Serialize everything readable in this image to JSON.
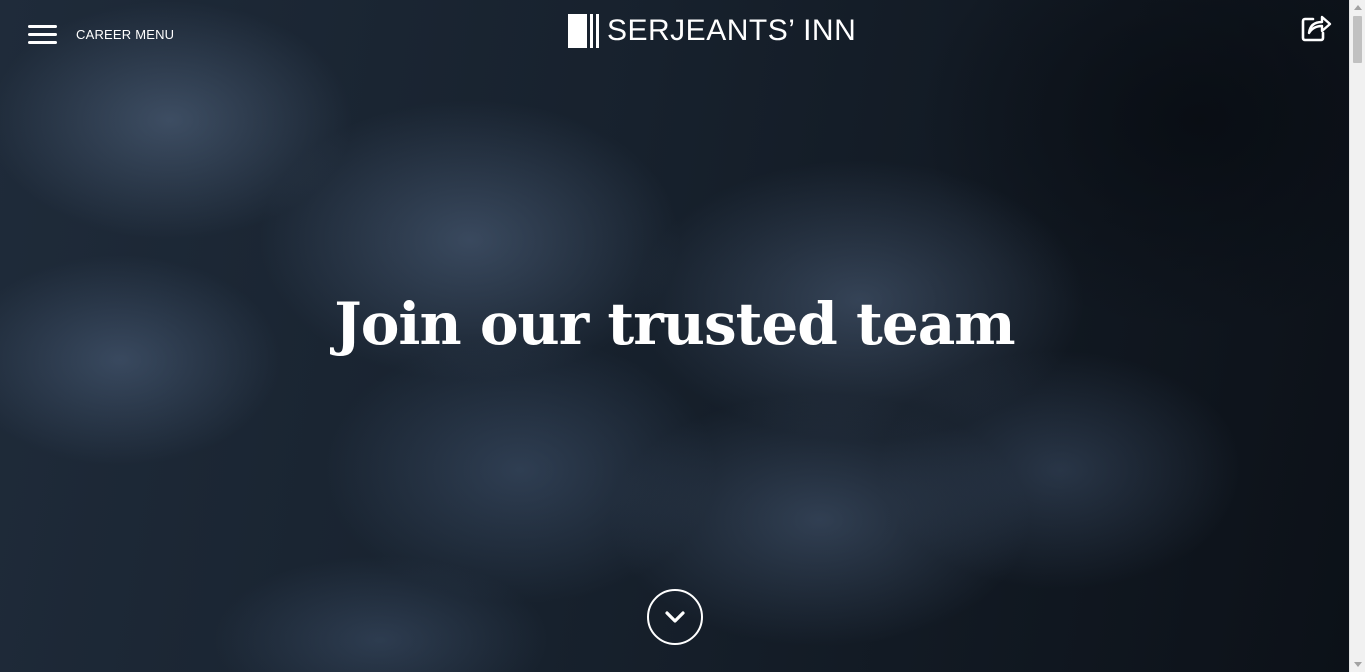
{
  "header": {
    "menu_label": "CAREER MENU",
    "logo_text": "SERJEANTS’ INN"
  },
  "icons": {
    "menu": "hamburger-icon",
    "share": "share-icon",
    "scroll": "chevron-down-icon"
  },
  "hero": {
    "headline": "Join our trusted team"
  },
  "colors": {
    "text": "#ffffff",
    "background": "#17212d"
  }
}
